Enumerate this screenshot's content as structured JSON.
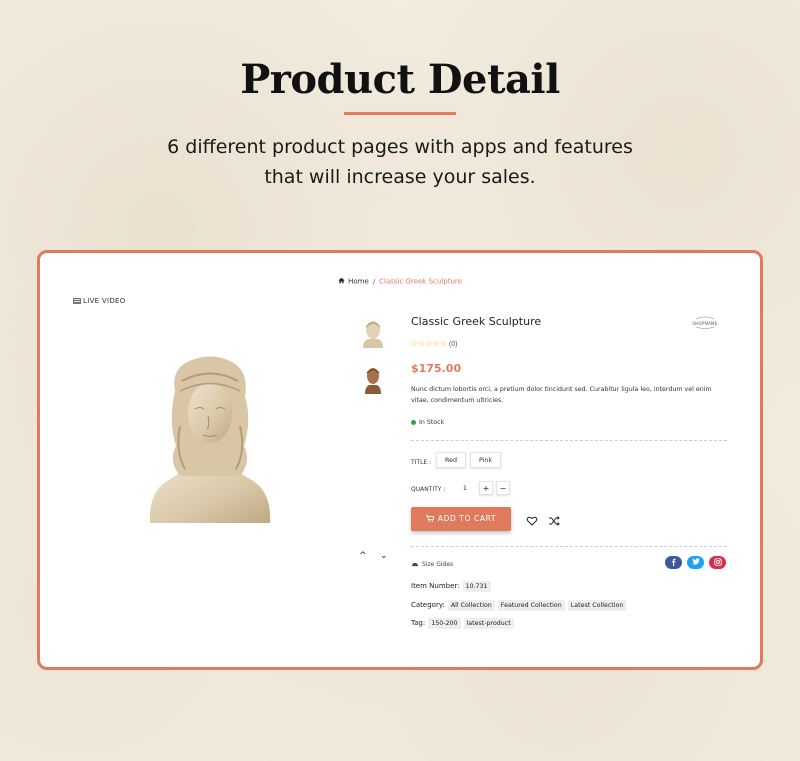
{
  "hero": {
    "title": "Product Detail",
    "subtitle_line1": "6 different product pages with apps and features",
    "subtitle_line2": "that will increase your sales."
  },
  "breadcrumb": {
    "home": "Home",
    "separator": "/",
    "current": "Classic Greek Sculpture"
  },
  "media": {
    "live_video": "LIVE VIDEO"
  },
  "product": {
    "title": "Classic Greek Sculpture",
    "brand_logo_text": "SHOPNAME",
    "rating_stars": "☆☆☆☆☆",
    "rating_count": "(0)",
    "price": "$175.00",
    "description": "Nunc dictum lobortis orci, a pretium dolor tincidunt sed. Curabitur ligula leo, interdum vel enim vitae, condimentum ultricies.",
    "stock": "In Stock",
    "title_label": "TITLE :",
    "variants": [
      "Red",
      "Pink"
    ],
    "quantity_label": "QUANTITY :",
    "quantity": "1",
    "plus": "+",
    "minus": "−",
    "add_to_cart": "ADD TO CART",
    "size_guide": "Size Gides",
    "item_number_label": "Item Number:",
    "item_number": "10.731",
    "category_label": "Category:",
    "categories": [
      "All Collection",
      "Featured Collection",
      "Latest Collection"
    ],
    "tag_label": "Tag:",
    "tags": [
      "150-200",
      "latest-product"
    ]
  },
  "colors": {
    "accent": "#e07a5c",
    "facebook": "#3b5998",
    "twitter": "#1da1f2",
    "instagram": "#d62f4d",
    "in_stock": "#2ea44f"
  },
  "icons": [
    "home-icon",
    "video-icon",
    "star-icon",
    "cart-icon",
    "heart-icon",
    "shuffle-icon",
    "ruler-icon",
    "facebook-icon",
    "twitter-icon",
    "instagram-icon",
    "chevron-up-icon",
    "chevron-down-icon"
  ]
}
